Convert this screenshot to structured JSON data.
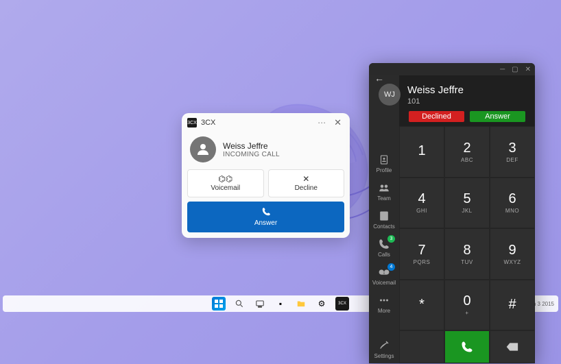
{
  "call_card": {
    "app_name": "3CX",
    "app_icon_text": "3CX",
    "caller_name": "Weiss Jeffre",
    "status": "INCOMING CALL",
    "voicemail_label": "Voicemail",
    "decline_label": "Decline",
    "answer_label": "Answer"
  },
  "dialer": {
    "caller_initials": "WJ",
    "caller_name": "Weiss Jeffre",
    "extension": "101",
    "status_declined": "Declined",
    "status_answer": "Answer",
    "sidebar": {
      "profile": "Profile",
      "team": "Team",
      "contacts": "Contacts",
      "calls": "Calls",
      "calls_badge": "3",
      "voicemail": "Voicemail",
      "voicemail_badge": "4",
      "more": "More",
      "settings": "Settings"
    },
    "keys": [
      {
        "d": "1",
        "l": ""
      },
      {
        "d": "2",
        "l": "ABC"
      },
      {
        "d": "3",
        "l": "DEF"
      },
      {
        "d": "4",
        "l": "GHI"
      },
      {
        "d": "5",
        "l": "JKL"
      },
      {
        "d": "6",
        "l": "MNO"
      },
      {
        "d": "7",
        "l": "PQRS"
      },
      {
        "d": "8",
        "l": "TUV"
      },
      {
        "d": "9",
        "l": "WXYZ"
      },
      {
        "d": "*",
        "l": ""
      },
      {
        "d": "0",
        "l": "+"
      },
      {
        "d": "#",
        "l": ""
      }
    ]
  },
  "taskbar": {
    "time_hint": "ch 3 2015"
  }
}
